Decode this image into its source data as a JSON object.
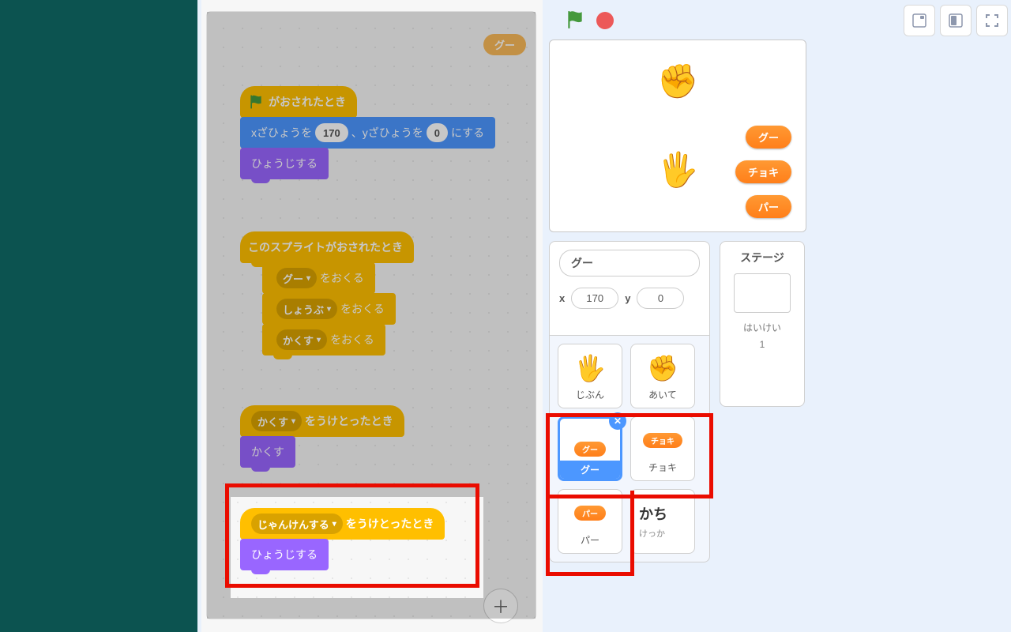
{
  "sprite_pill": "グー",
  "blocks": {
    "hat1": "がおされたとき",
    "gotoxy_pre": "xざひょうを",
    "gotoxy_x": "170",
    "gotoxy_mid": "、yざひょうを",
    "gotoxy_y": "0",
    "gotoxy_post": "にする",
    "show": "ひょうじする",
    "hat2": "このスプライトがおされたとき",
    "send": "をおくる",
    "opt_gu": "グー",
    "opt_shoubu": "しょうぶ",
    "opt_kakusu": "かくす",
    "hat3_pre": "",
    "hat3_drop": "かくす",
    "hat3_post": "をうけとったとき",
    "hide": "かくす",
    "hat4_drop": "じゃんけんする",
    "hat4_post": "をうけとったとき",
    "show2": "ひょうじする"
  },
  "stage_buttons": {
    "gu": "グー",
    "choki": "チョキ",
    "pa": "パー"
  },
  "sprite_info": {
    "name": "グー",
    "x_lbl": "x",
    "x": "170",
    "y_lbl": "y",
    "y": "0"
  },
  "stage_panel": {
    "title": "ステージ",
    "haikei": "はいけい",
    "count": "1"
  },
  "sprites": {
    "jibun": "じぶん",
    "aite": "あいて",
    "gu": "グー",
    "choki": "チョキ",
    "pa": "パー",
    "gu_mini": "グー",
    "choki_mini": "チョキ",
    "pa_mini": "パー",
    "kachi": "かち",
    "kekka": "けっか"
  },
  "colors": {
    "event": "#ffbf00",
    "motion": "#4c97ff",
    "looks": "#9966ff"
  }
}
